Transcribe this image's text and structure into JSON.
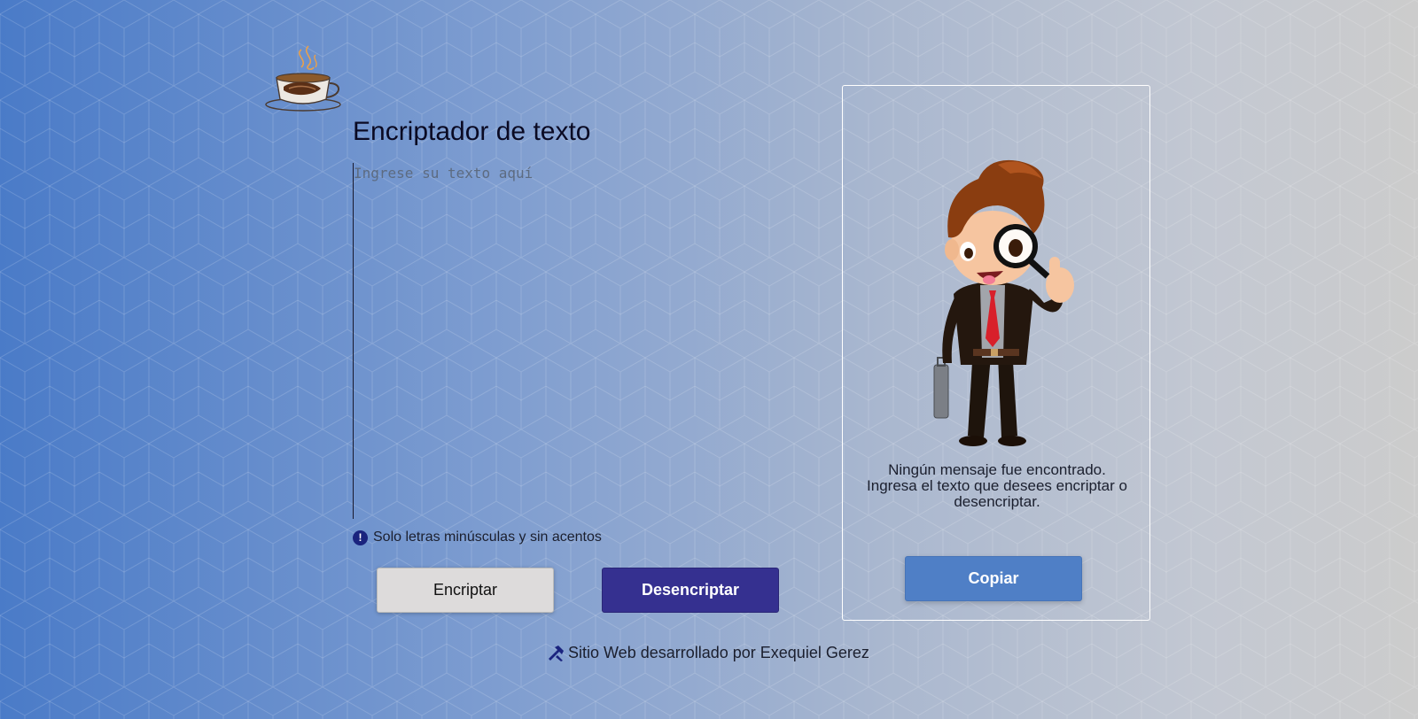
{
  "header": {
    "title": "Encriptador de texto",
    "logo_icon": "coffee-cup-icon"
  },
  "input": {
    "placeholder": "Ingrese su texto aquí",
    "value": ""
  },
  "hint": {
    "icon": "exclamation-circle-icon",
    "text": "Solo letras minúsculas y sin acentos"
  },
  "buttons": {
    "encrypt_label": "Encriptar",
    "decrypt_label": "Desencriptar",
    "copy_label": "Copiar"
  },
  "result": {
    "illustration": "detective-with-magnifying-glass",
    "message_line1": "Ningún mensaje fue encontrado.",
    "message_line2": "Ingresa el texto que desees encriptar o desencriptar."
  },
  "footer": {
    "icon": "tools-icon",
    "text": "Sitio Web desarrollado por Exequiel Gerez"
  },
  "colors": {
    "primary_dark": "#353090",
    "accent_blue": "#4f7fc6",
    "secondary_button": "#dddbdb",
    "text_dark": "#0a0a23"
  }
}
